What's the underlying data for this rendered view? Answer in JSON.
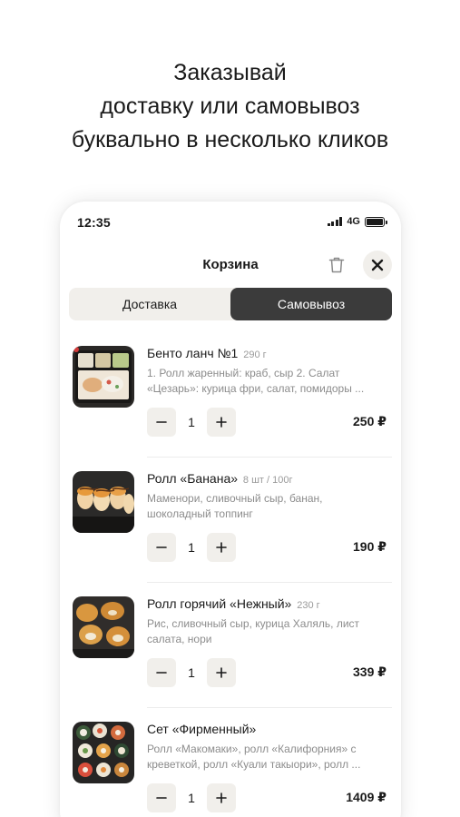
{
  "headline": [
    "Заказывай",
    "доставку или самовывоз",
    "буквально в несколько кликов"
  ],
  "status": {
    "time": "12:35",
    "network": "4G"
  },
  "cart": {
    "title": "Корзина",
    "tabs": [
      {
        "label": "Доставка",
        "selected": false
      },
      {
        "label": "Самовывоз",
        "selected": true
      }
    ],
    "items": [
      {
        "name": "Бенто ланч №1",
        "weight": "290 г",
        "description": "1. Ролл жаренный: краб, сыр 2. Салат «Цезарь»: курица фри, салат, помидоры ...",
        "quantity": "1",
        "price": "250 ₽"
      },
      {
        "name": "Ролл «Банана»",
        "weight": "8 шт / 100г",
        "description": "Маменори, сливочный сыр, банан, шоколадный топпинг",
        "quantity": "1",
        "price": "190 ₽"
      },
      {
        "name": "Ролл горячий «Нежный»",
        "weight": "230 г",
        "description": "Рис, сливочный сыр, курица Халяль, лист салата, нори",
        "quantity": "1",
        "price": "339 ₽"
      },
      {
        "name": "Сет «Фирменный»",
        "weight": "",
        "description": "Ролл «Макомаки», ролл «Калифорния» с креветкой, ролл «Куали такыори», ролл ...",
        "quantity": "1",
        "price": "1409 ₽"
      }
    ]
  },
  "icons": {
    "trash": "trash-icon",
    "close": "close-icon",
    "minus": "minus-icon",
    "plus": "plus-icon"
  },
  "colors": {
    "accent_dark": "#3b3b3b",
    "chip_bg": "#f1efeb",
    "muted_text": "#8c8c8c"
  }
}
